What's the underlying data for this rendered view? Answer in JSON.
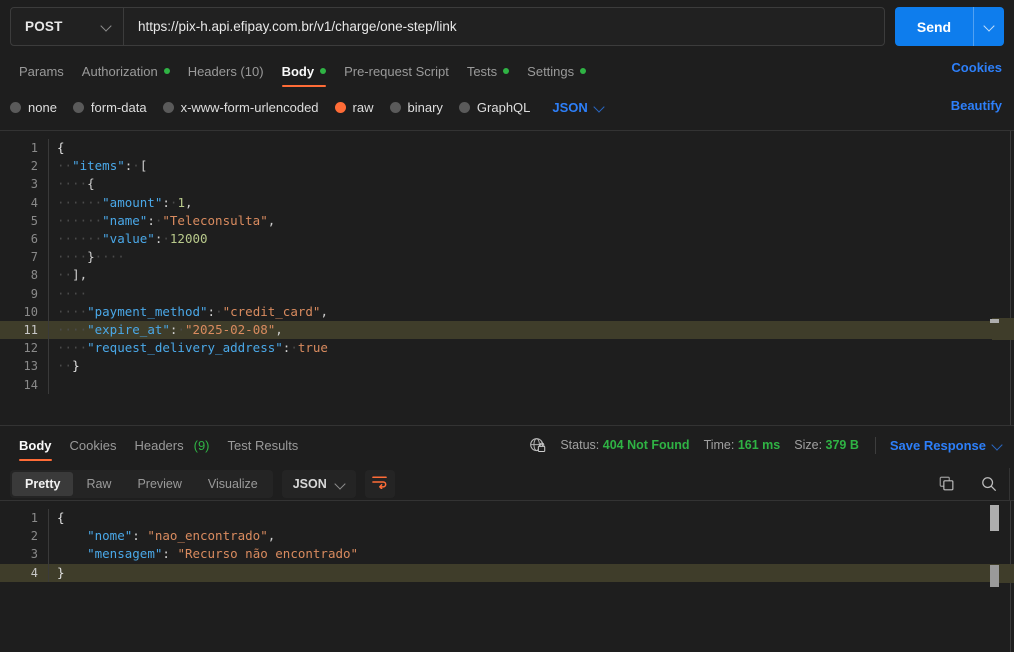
{
  "request": {
    "method": "POST",
    "url": "https://pix-h.api.efipay.com.br/v1/charge/one-step/link",
    "send_label": "Send",
    "tabs": [
      {
        "label": "Params",
        "dot": false,
        "active": false
      },
      {
        "label": "Authorization",
        "dot": true,
        "active": false
      },
      {
        "label": "Headers (10)",
        "dot": false,
        "active": false
      },
      {
        "label": "Body",
        "dot": true,
        "active": true
      },
      {
        "label": "Pre-request Script",
        "dot": false,
        "active": false
      },
      {
        "label": "Tests",
        "dot": true,
        "active": false
      },
      {
        "label": "Settings",
        "dot": true,
        "active": false
      }
    ],
    "cookies_link": "Cookies",
    "beautify_link": "Beautify",
    "body_types": [
      {
        "label": "none",
        "selected": false
      },
      {
        "label": "form-data",
        "selected": false
      },
      {
        "label": "x-www-form-urlencoded",
        "selected": false
      },
      {
        "label": "raw",
        "selected": true
      },
      {
        "label": "binary",
        "selected": false
      },
      {
        "label": "GraphQL",
        "selected": false
      }
    ],
    "raw_format": "JSON",
    "body_lines": [
      {
        "n": "1",
        "active": false,
        "tokens": [
          {
            "t": "{",
            "c": "br"
          }
        ]
      },
      {
        "n": "2",
        "active": false,
        "tokens": [
          {
            "t": "··",
            "c": "ws"
          },
          {
            "t": "\"items\"",
            "c": "k"
          },
          {
            "t": ":",
            "c": "p"
          },
          {
            "t": "·",
            "c": "ws"
          },
          {
            "t": "[",
            "c": "p"
          }
        ]
      },
      {
        "n": "3",
        "active": false,
        "tokens": [
          {
            "t": "····",
            "c": "ws"
          },
          {
            "t": "{",
            "c": "p"
          }
        ]
      },
      {
        "n": "4",
        "active": false,
        "tokens": [
          {
            "t": "······",
            "c": "ws"
          },
          {
            "t": "\"amount\"",
            "c": "k"
          },
          {
            "t": ":",
            "c": "p"
          },
          {
            "t": "·",
            "c": "ws"
          },
          {
            "t": "1",
            "c": "n"
          },
          {
            "t": ",",
            "c": "p"
          }
        ]
      },
      {
        "n": "5",
        "active": false,
        "tokens": [
          {
            "t": "······",
            "c": "ws"
          },
          {
            "t": "\"name\"",
            "c": "k"
          },
          {
            "t": ":",
            "c": "p"
          },
          {
            "t": "·",
            "c": "ws"
          },
          {
            "t": "\"Teleconsulta\"",
            "c": "s"
          },
          {
            "t": ",",
            "c": "p"
          }
        ]
      },
      {
        "n": "6",
        "active": false,
        "tokens": [
          {
            "t": "······",
            "c": "ws"
          },
          {
            "t": "\"value\"",
            "c": "k"
          },
          {
            "t": ":",
            "c": "p"
          },
          {
            "t": "·",
            "c": "ws"
          },
          {
            "t": "12000",
            "c": "n"
          }
        ]
      },
      {
        "n": "7",
        "active": false,
        "tokens": [
          {
            "t": "····",
            "c": "ws"
          },
          {
            "t": "}",
            "c": "p"
          },
          {
            "t": "····",
            "c": "ws"
          }
        ]
      },
      {
        "n": "8",
        "active": false,
        "tokens": [
          {
            "t": "··",
            "c": "ws"
          },
          {
            "t": "],",
            "c": "p"
          }
        ]
      },
      {
        "n": "9",
        "active": false,
        "tokens": [
          {
            "t": "····",
            "c": "ws"
          }
        ]
      },
      {
        "n": "10",
        "active": false,
        "tokens": [
          {
            "t": "····",
            "c": "ws"
          },
          {
            "t": "\"payment_method\"",
            "c": "k"
          },
          {
            "t": ":",
            "c": "p"
          },
          {
            "t": "·",
            "c": "ws"
          },
          {
            "t": "\"credit_card\"",
            "c": "s"
          },
          {
            "t": ",",
            "c": "p"
          }
        ]
      },
      {
        "n": "11",
        "active": true,
        "tokens": [
          {
            "t": "····",
            "c": "ws"
          },
          {
            "t": "\"expire_at\"",
            "c": "k"
          },
          {
            "t": ":",
            "c": "p"
          },
          {
            "t": "·",
            "c": "ws"
          },
          {
            "t": "\"2025-02-08\"",
            "c": "s"
          },
          {
            "t": ",",
            "c": "p"
          }
        ]
      },
      {
        "n": "12",
        "active": false,
        "tokens": [
          {
            "t": "····",
            "c": "ws"
          },
          {
            "t": "\"request_delivery_address\"",
            "c": "k"
          },
          {
            "t": ":",
            "c": "p"
          },
          {
            "t": "·",
            "c": "ws"
          },
          {
            "t": "true",
            "c": "b"
          }
        ]
      },
      {
        "n": "13",
        "active": false,
        "tokens": [
          {
            "t": "··",
            "c": "ws"
          },
          {
            "t": "}",
            "c": "br"
          }
        ]
      },
      {
        "n": "14",
        "active": false,
        "tokens": []
      }
    ]
  },
  "response": {
    "tabs": [
      {
        "label": "Body",
        "active": true,
        "count": ""
      },
      {
        "label": "Cookies",
        "active": false,
        "count": ""
      },
      {
        "label": "Headers",
        "active": false,
        "count": "(9)"
      },
      {
        "label": "Test Results",
        "active": false,
        "count": ""
      }
    ],
    "status_label": "Status:",
    "status_value": "404 Not Found",
    "time_label": "Time:",
    "time_value": "161 ms",
    "size_label": "Size:",
    "size_value": "379 B",
    "save_response": "Save Response",
    "format_tabs": [
      {
        "label": "Pretty",
        "active": true
      },
      {
        "label": "Raw",
        "active": false
      },
      {
        "label": "Preview",
        "active": false
      },
      {
        "label": "Visualize",
        "active": false
      }
    ],
    "format_select": "JSON",
    "body_lines": [
      {
        "n": "1",
        "active": false,
        "tokens": [
          {
            "t": "{",
            "c": "br"
          }
        ]
      },
      {
        "n": "2",
        "active": false,
        "tokens": [
          {
            "t": "    ",
            "c": "ws"
          },
          {
            "t": "\"nome\"",
            "c": "k"
          },
          {
            "t": ":",
            "c": "p"
          },
          {
            "t": " ",
            "c": "ws"
          },
          {
            "t": "\"nao_encontrado\"",
            "c": "s"
          },
          {
            "t": ",",
            "c": "p"
          }
        ]
      },
      {
        "n": "3",
        "active": false,
        "tokens": [
          {
            "t": "    ",
            "c": "ws"
          },
          {
            "t": "\"mensagem\"",
            "c": "k"
          },
          {
            "t": ":",
            "c": "p"
          },
          {
            "t": " ",
            "c": "ws"
          },
          {
            "t": "\"Recurso não encontrado\"",
            "c": "s"
          }
        ]
      },
      {
        "n": "4",
        "active": true,
        "tokens": [
          {
            "t": "}",
            "c": "br"
          }
        ]
      }
    ]
  },
  "colors": {
    "accent": "#ff6c37",
    "link": "#2d7ff9",
    "success": "#2fb344",
    "send": "#0e7ded",
    "background": "#1e1e1e",
    "highlight_line": "#3f3d2a"
  }
}
